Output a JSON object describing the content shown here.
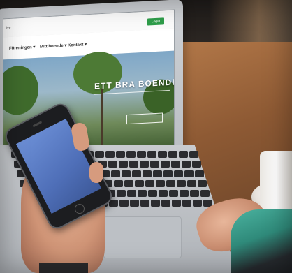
{
  "website": {
    "url_fragment": "ive",
    "nav": [
      "Föreningen ▾",
      "Mitt boende ▾",
      "Kontakt ▾"
    ],
    "login_label": "Login",
    "hero_title": "ETT BRA BOENDE"
  },
  "colors": {
    "login_green": "#2e9d4a",
    "phone_screen": "#5a7ac6",
    "sleeve_teal": "#3aa08e",
    "table_wood": "#9a6a44"
  }
}
